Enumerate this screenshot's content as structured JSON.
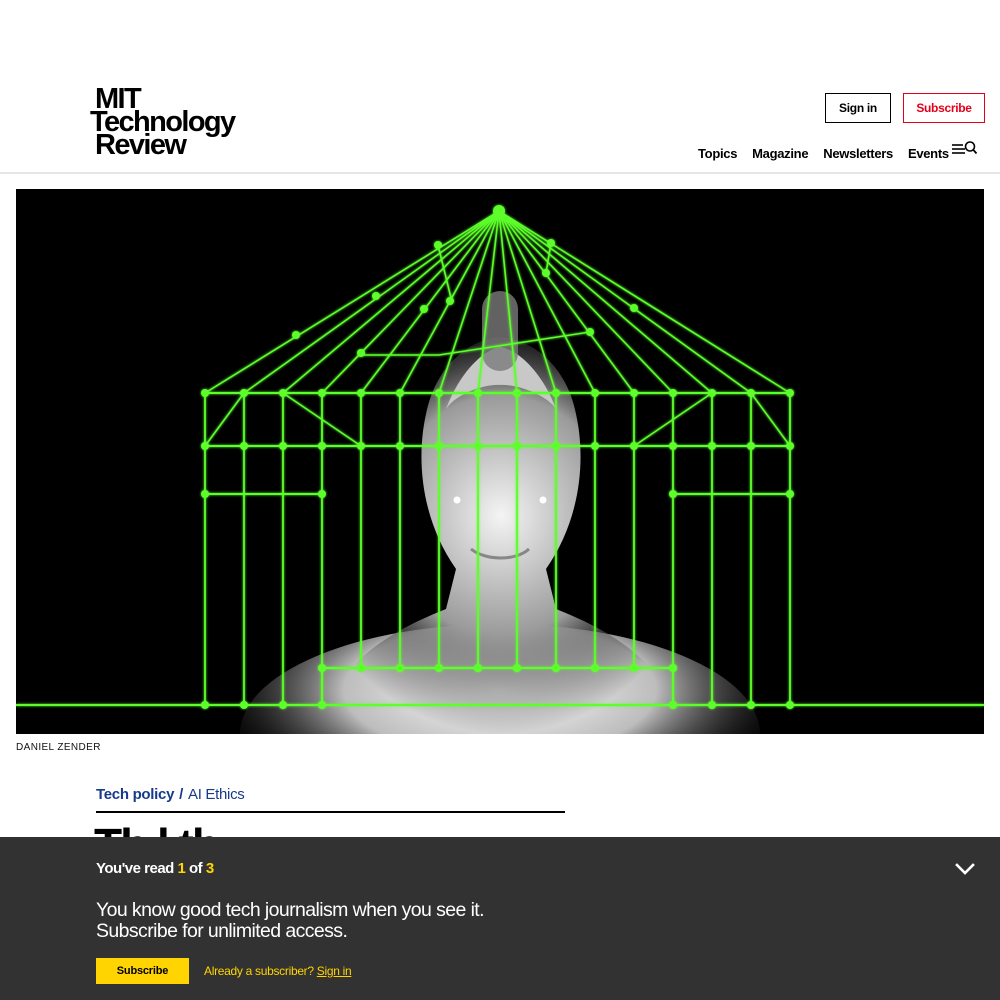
{
  "header": {
    "logo_lines": [
      "MIT",
      "Technology",
      "Review"
    ],
    "sign_in_label": "Sign in",
    "subscribe_label": "Subscribe",
    "nav": [
      "Topics",
      "Magazine",
      "Newsletters",
      "Events"
    ],
    "menu_icon": "menu-search-icon"
  },
  "hero": {
    "credit": "DANIEL ZENDER"
  },
  "article": {
    "topic_primary": "Tech policy",
    "topic_separator": "/",
    "topic_secondary": "AI Ethics",
    "headline_fragment": "Th      l       th"
  },
  "paywall": {
    "read_prefix": "You've read ",
    "read_current": "1",
    "read_of": " of ",
    "read_total": "3",
    "pitch_line1": "You know good tech journalism when you see it.",
    "pitch_line2": "Subscribe for unlimited access.",
    "subscribe_label": "Subscribe",
    "already_text": "Already a subscriber? ",
    "sign_in_link": "Sign in",
    "collapse_icon": "chevron-down-icon"
  },
  "colors": {
    "subscribe_red": "#e3001b",
    "topic_blue": "#173a8c",
    "paywall_bg": "#323232",
    "accent_yellow": "#ffd400",
    "cage_green": "#5cff2a"
  }
}
